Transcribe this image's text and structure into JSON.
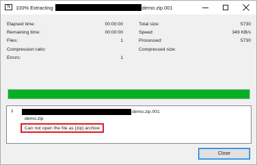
{
  "window": {
    "title_prefix": "100% Extracting",
    "title_suffix": "demo.zip.001",
    "app_icon_text": "7z",
    "controls": [
      "minimize-icon",
      "maximize-icon",
      "close-icon"
    ]
  },
  "stats_left": [
    {
      "label": "Elapsed time:",
      "value": "00:00:00"
    },
    {
      "label": "Remaining time:",
      "value": "00:00:00"
    },
    {
      "label": "Files:",
      "value": "1"
    },
    {
      "label": "Compression ratio:",
      "value": ""
    },
    {
      "label": "Errors:",
      "value": "1"
    }
  ],
  "stats_right": [
    {
      "label": "Total size:",
      "value": "5730"
    },
    {
      "label": "Speed:",
      "value": "349 KB/s"
    },
    {
      "label": "Processed:",
      "value": "5730"
    },
    {
      "label": "Compressed size:",
      "value": ""
    }
  ],
  "progress": {
    "percent": 100,
    "color": "#06b025"
  },
  "messages": {
    "index": "1",
    "archive_suffix": "demo.zip.001",
    "inner_file": "demo.zip",
    "error": "Can not open the file as [zip] archive",
    "highlight_color": "#e8141e"
  },
  "buttons": {
    "close_label": "Close"
  }
}
